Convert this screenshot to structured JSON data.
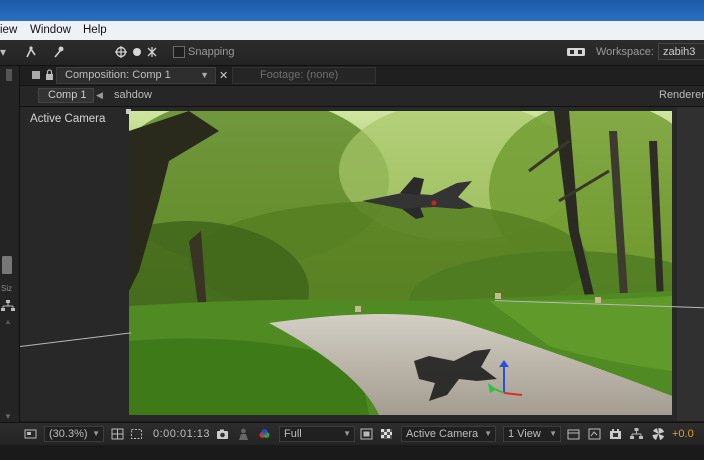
{
  "menu": {
    "items": [
      "iew",
      "Window",
      "Help"
    ]
  },
  "toolbar": {
    "snapping_label": "Snapping",
    "workspace_label": "Workspace:",
    "workspace_value": "zabih3"
  },
  "tabs": {
    "composition": "Composition: Comp 1",
    "footage": "Footage: (none)"
  },
  "breadcrumb": {
    "comp": "Comp 1",
    "layer": "sahdow",
    "renderer": "Renderer:"
  },
  "left_panel": {
    "label": "Siz"
  },
  "viewer": {
    "camera_label": "Active Camera"
  },
  "bottom_bar": {
    "magnification": "(30.3%)",
    "timecode": "0:00:01:13",
    "resolution": "Full",
    "camera_view": "Active Camera",
    "view_layout": "1 View",
    "exposure": "+0.0"
  },
  "icons": {
    "toolbar": [
      "selection-arrow-icon",
      "puppet-icon",
      "pin-icon",
      "axis-icon",
      "sphere-icon",
      "local-axis-icon"
    ],
    "bottom": [
      "monitor-icon",
      "grid-icon",
      "mask-icon",
      "snapshot-icon",
      "show-snapshot-icon",
      "color-channels-icon",
      "region-icon",
      "transparency-grid-icon",
      "fast-preview-icon",
      "flowchart-icon",
      "timeline-icon",
      "draft-3d-icon",
      "exposure-reset-icon"
    ]
  },
  "colors": {
    "title_bar": "#2a6fc0",
    "exposure_text": "#e0a020",
    "panel_bg": "#282828"
  }
}
